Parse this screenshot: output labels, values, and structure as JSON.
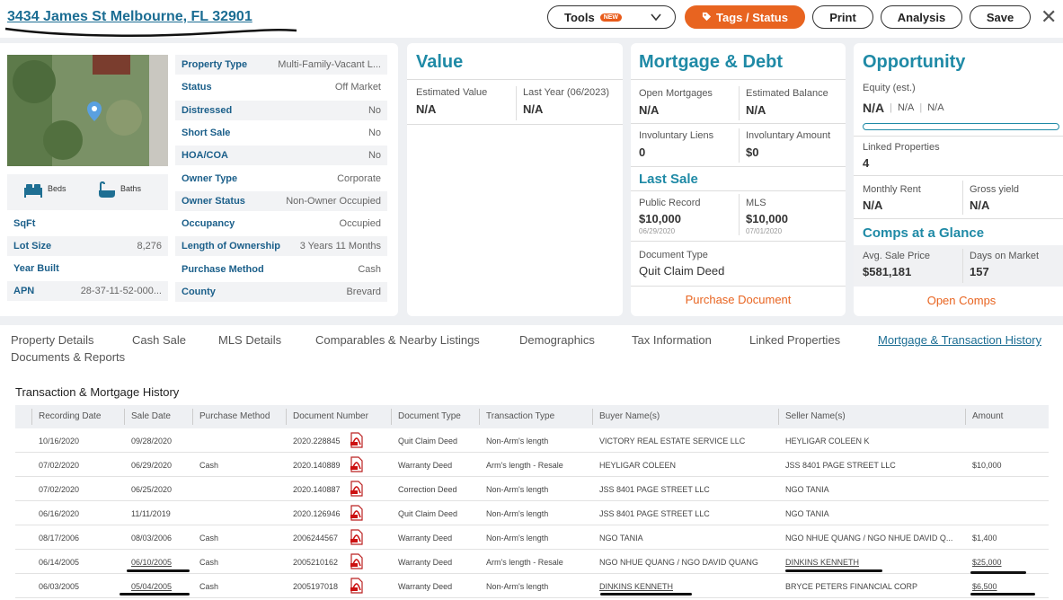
{
  "header": {
    "address": "3434 James St Melbourne, FL 32901",
    "tools_label": "Tools",
    "new_badge": "NEW",
    "tags_label": "Tags / Status",
    "print_label": "Print",
    "analysis_label": "Analysis",
    "save_label": "Save",
    "close_label": "✕"
  },
  "summary": {
    "beds_label": "Beds",
    "baths_label": "Baths",
    "left": [
      {
        "k": "SqFt",
        "v": ""
      },
      {
        "k": "Lot Size",
        "v": "8,276"
      },
      {
        "k": "Year Built",
        "v": ""
      },
      {
        "k": "APN",
        "v": "28-37-11-52-000..."
      }
    ],
    "right": [
      {
        "k": "Property Type",
        "v": "Multi-Family-Vacant L..."
      },
      {
        "k": "Status",
        "v": "Off Market"
      },
      {
        "k": "Distressed",
        "v": "No"
      },
      {
        "k": "Short Sale",
        "v": "No"
      },
      {
        "k": "HOA/COA",
        "v": "No"
      },
      {
        "k": "Owner Type",
        "v": "Corporate"
      },
      {
        "k": "Owner Status",
        "v": "Non-Owner Occupied"
      },
      {
        "k": "Occupancy",
        "v": "Occupied"
      },
      {
        "k": "Length of Ownership",
        "v": "3 Years 11 Months"
      },
      {
        "k": "Purchase Method",
        "v": "Cash"
      },
      {
        "k": "County",
        "v": "Brevard"
      }
    ]
  },
  "value_card": {
    "title": "Value",
    "est_label": "Estimated Value",
    "est_value": "N/A",
    "last_year_label": "Last Year (06/2023)",
    "last_year_value": "N/A"
  },
  "mortgage_card": {
    "title": "Mortgage & Debt",
    "open_label": "Open Mortgages",
    "open_value": "N/A",
    "balance_label": "Estimated Balance",
    "balance_value": "N/A",
    "liens_label": "Involuntary Liens",
    "liens_value": "0",
    "inv_amount_label": "Involuntary Amount",
    "inv_amount_value": "$0",
    "last_sale_title": "Last Sale",
    "public_label": "Public Record",
    "public_value": "$10,000",
    "public_date": "06/29/2020",
    "mls_label": "MLS",
    "mls_value": "$10,000",
    "mls_date": "07/01/2020",
    "doc_type_label": "Document Type",
    "doc_type_value": "Quit Claim Deed",
    "purchase_doc_link": "Purchase Document"
  },
  "opportunity_card": {
    "title": "Opportunity",
    "equity_label": "Equity (est.)",
    "equity_values": [
      "N/A",
      "N/A",
      "N/A"
    ],
    "equity_fill": 0,
    "linked_label": "Linked Properties",
    "linked_value": "4",
    "rent_label": "Monthly Rent",
    "rent_value": "N/A",
    "yield_label": "Gross yield",
    "yield_value": "N/A",
    "comps_title": "Comps at a Glance",
    "avg_label": "Avg. Sale Price",
    "avg_value": "$581,181",
    "dom_label": "Days on Market",
    "dom_value": "157",
    "open_comps_link": "Open Comps"
  },
  "tabs": [
    "Property Details",
    "Cash Sale",
    "MLS Details",
    "Comparables & Nearby Listings",
    "Demographics",
    "Tax Information",
    "Linked Properties",
    "Mortgage & Transaction History",
    "Documents & Reports"
  ],
  "transactions": {
    "title": "Transaction & Mortgage History",
    "columns": [
      "Recording Date",
      "Sale Date",
      "Purchase Method",
      "Document Number",
      "Document Type",
      "Transaction Type",
      "Buyer Name(s)",
      "Seller Name(s)",
      "Amount"
    ],
    "rows": [
      [
        "10/16/2020",
        "09/28/2020",
        "",
        "2020.228845",
        "Quit Claim Deed",
        "Non-Arm's length",
        "VICTORY REAL ESTATE SERVICE LLC",
        "HEYLIGAR COLEEN K",
        ""
      ],
      [
        "07/02/2020",
        "06/29/2020",
        "Cash",
        "2020.140889",
        "Warranty Deed",
        "Arm's length - Resale",
        "HEYLIGAR COLEEN",
        "JSS 8401 PAGE STREET LLC",
        "$10,000"
      ],
      [
        "07/02/2020",
        "06/25/2020",
        "",
        "2020.140887",
        "Correction Deed",
        "Non-Arm's length",
        "JSS 8401 PAGE STREET LLC",
        "NGO TANIA",
        ""
      ],
      [
        "06/16/2020",
        "11/11/2019",
        "",
        "2020.126946",
        "Quit Claim Deed",
        "Non-Arm's length",
        "JSS 8401 PAGE STREET LLC",
        "NGO TANIA",
        ""
      ],
      [
        "08/17/2006",
        "08/03/2006",
        "Cash",
        "2006244567",
        "Warranty Deed",
        "Non-Arm's length",
        "NGO TANIA",
        "NGO NHUE QUANG / NGO NHUE DAVID Q...",
        "$1,400"
      ],
      [
        "06/14/2005",
        "06/10/2005",
        "Cash",
        "2005210162",
        "Warranty Deed",
        "Arm's length - Resale",
        "NGO NHUE QUANG / NGO DAVID QUANG",
        "DINKINS KENNETH",
        "$25,000"
      ],
      [
        "06/03/2005",
        "05/04/2005",
        "Cash",
        "2005197018",
        "Warranty Deed",
        "Non-Arm's length",
        "DINKINS KENNETH",
        "BRYCE PETERS FINANCIAL CORP",
        "$6,500"
      ]
    ]
  },
  "colors": {
    "accent": "#1f8aa6",
    "orange": "#e86420",
    "link": "#1b6d93"
  }
}
